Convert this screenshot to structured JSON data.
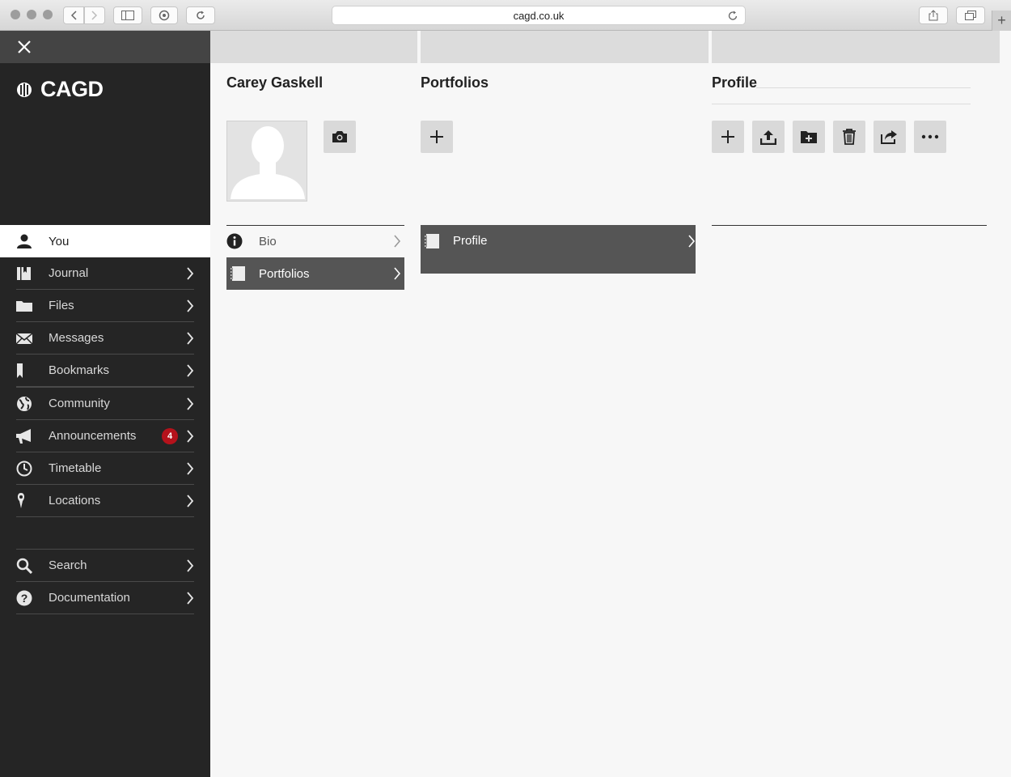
{
  "browser": {
    "url": "cagd.co.uk"
  },
  "sidebar": {
    "brand": "CAGD",
    "primary": [
      {
        "label": "You",
        "icon": "person-icon"
      },
      {
        "label": "Journal",
        "icon": "journal-icon"
      },
      {
        "label": "Files",
        "icon": "folder-icon"
      },
      {
        "label": "Messages",
        "icon": "envelope-icon"
      },
      {
        "label": "Bookmarks",
        "icon": "bookmark-icon"
      }
    ],
    "secondary": [
      {
        "label": "Community",
        "icon": "globe-icon"
      },
      {
        "label": "Announcements",
        "icon": "megaphone-icon",
        "badge": "4"
      },
      {
        "label": "Timetable",
        "icon": "clock-icon"
      },
      {
        "label": "Locations",
        "icon": "map-pin-icon"
      }
    ],
    "tertiary": [
      {
        "label": "Search",
        "icon": "search-icon"
      },
      {
        "label": "Documentation",
        "icon": "help-icon"
      }
    ]
  },
  "columns": {
    "user": {
      "title": "Carey Gaskell",
      "items": [
        {
          "label": "Bio",
          "icon": "info-icon"
        },
        {
          "label": "Portfolios",
          "icon": "notebook-icon"
        }
      ]
    },
    "portfolios": {
      "title": "Portfolios",
      "items": [
        {
          "label": "Profile",
          "icon": "notebook-icon"
        }
      ]
    },
    "profile": {
      "title": "Profile"
    }
  },
  "colors": {
    "sidebar_bg": "#252525",
    "selected_row": "#555555",
    "badge": "#b5121b"
  }
}
